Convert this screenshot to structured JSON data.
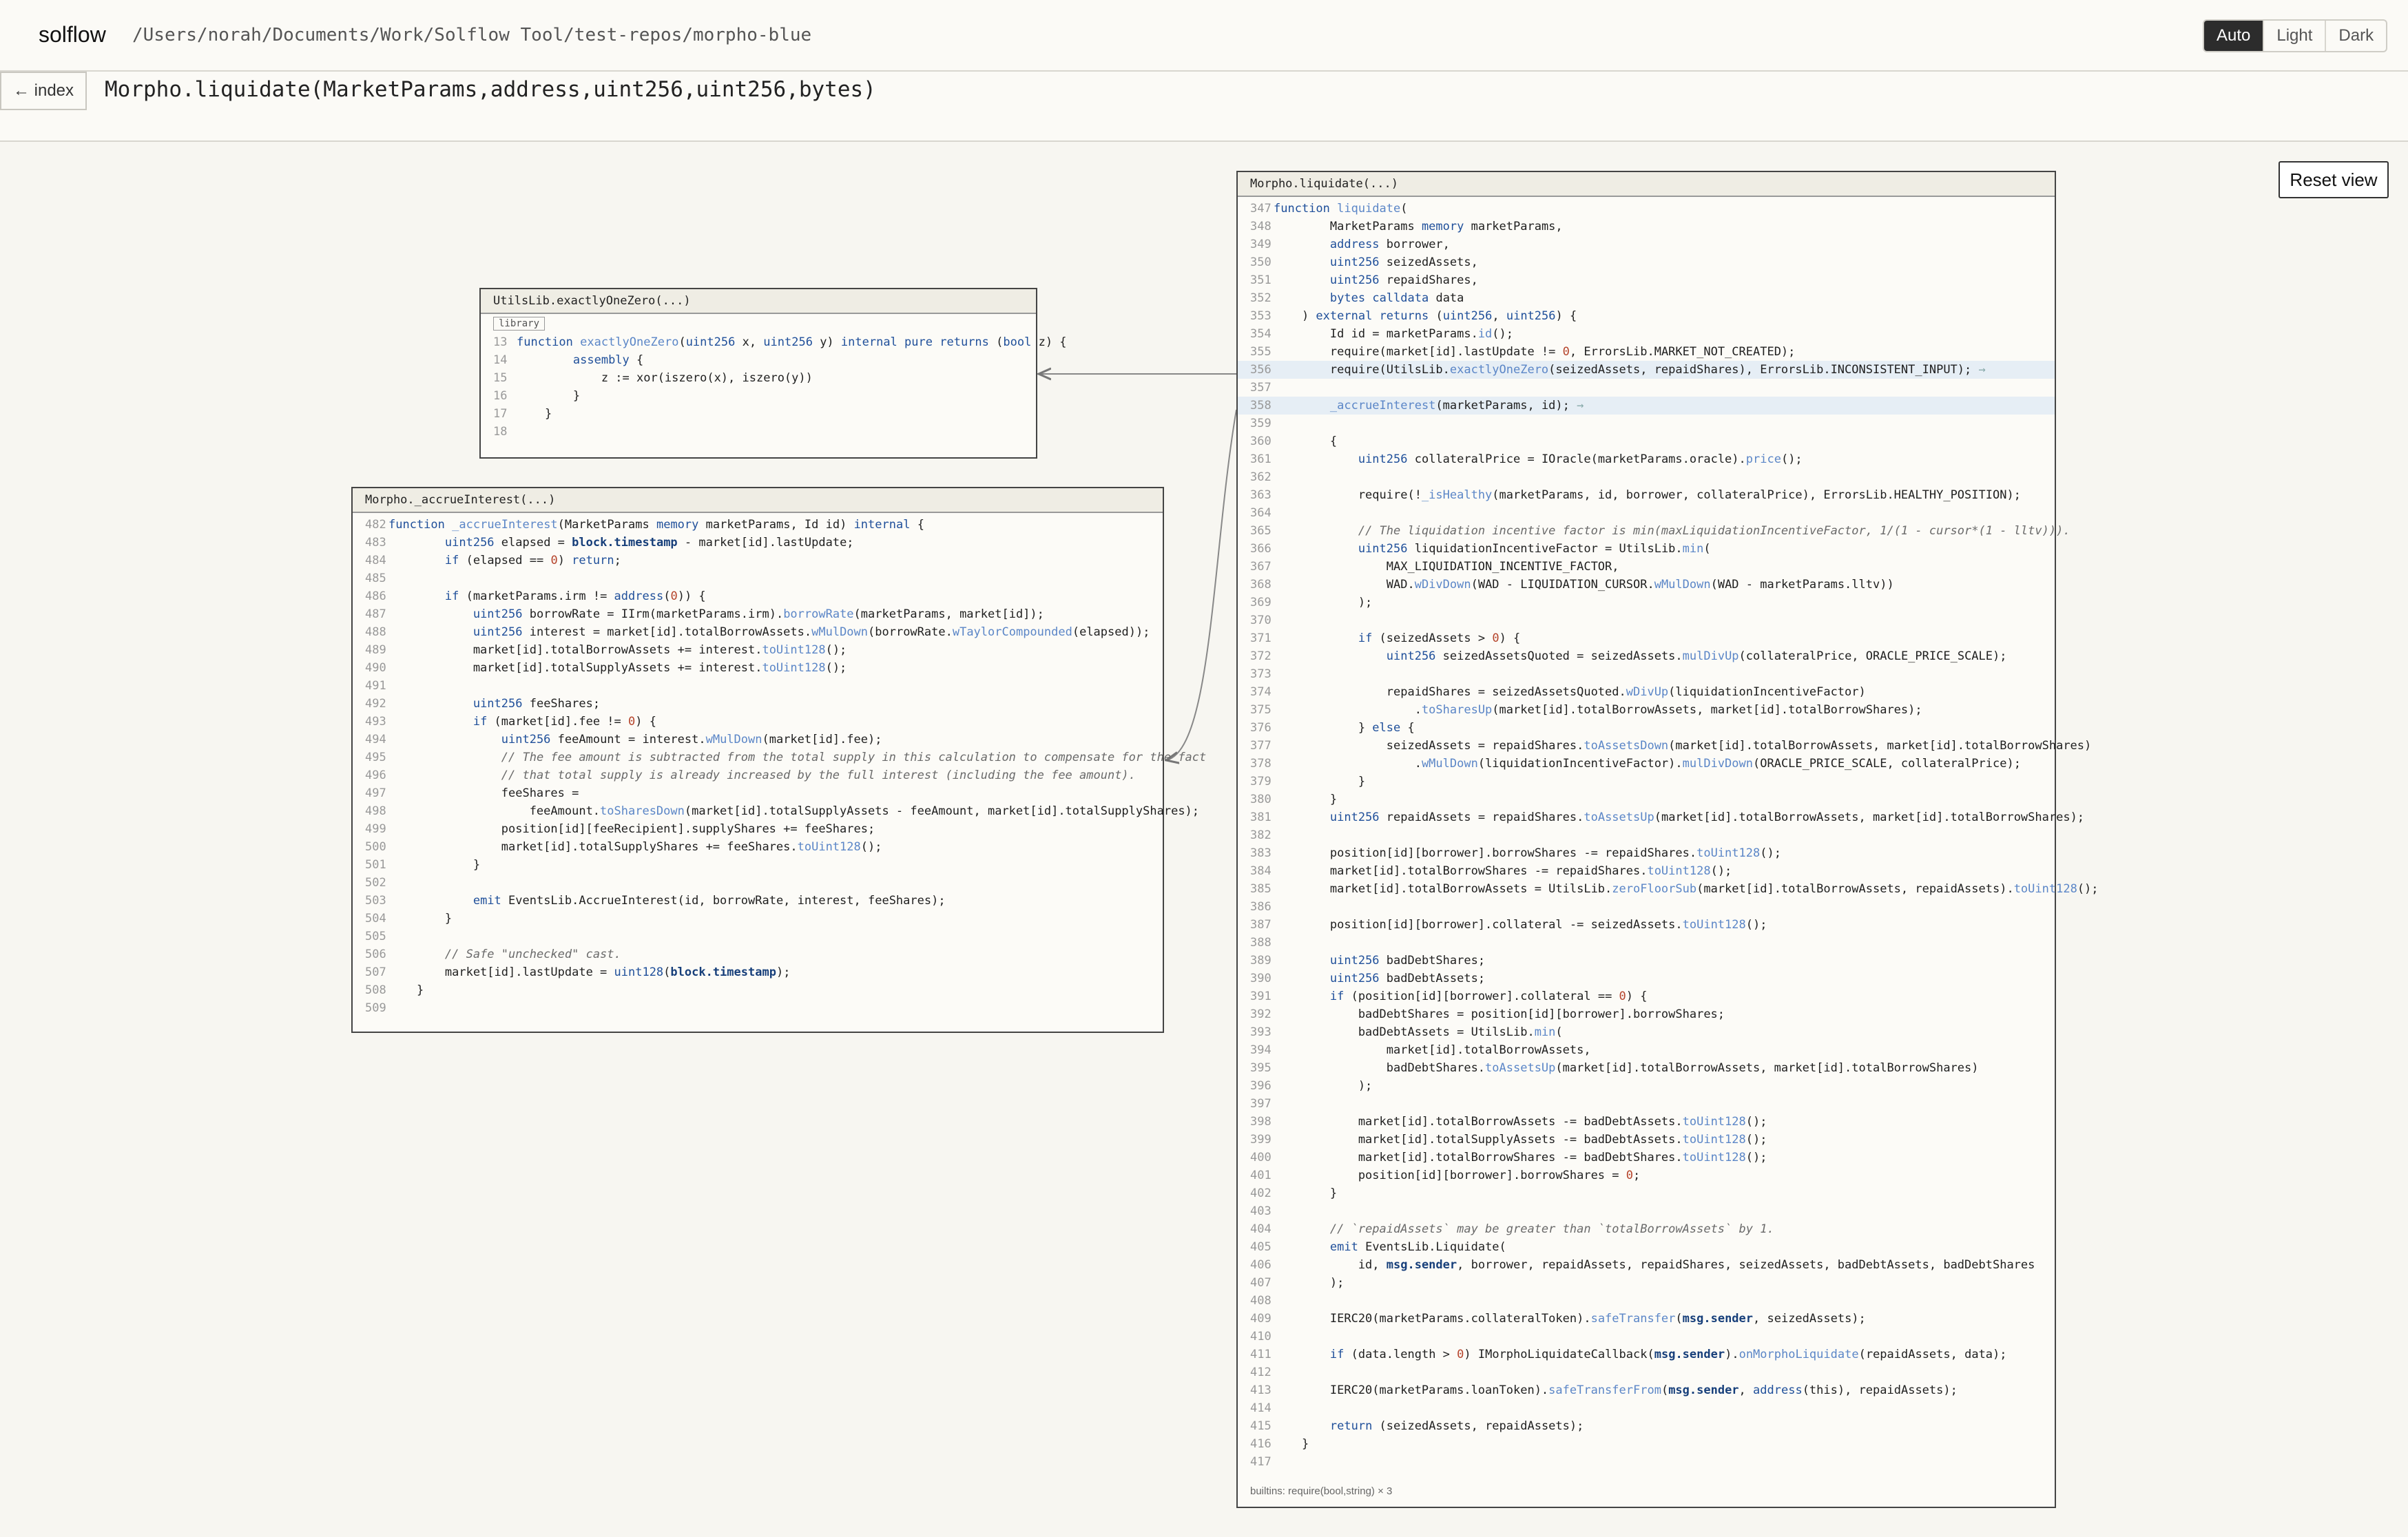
{
  "header": {
    "brand": "solflow",
    "path": "/Users/norah/Documents/Work/Solflow Tool/test-repos/morpho-blue",
    "themes": [
      "Auto",
      "Light",
      "Dark"
    ]
  },
  "toolbar": {
    "back_label": "← index",
    "signature": "Morpho.liquidate(MarketParams,address,uint256,uint256,bytes)",
    "reset_label": "Reset view"
  },
  "panels": {
    "exactly": {
      "title": "UtilsLib.exactlyOneZero(...)",
      "tag": "library",
      "start": 13,
      "lines": [
        "function exactlyOneZero(uint256 x, uint256 y) internal pure returns (bool z) {",
        "        assembly {",
        "            z := xor(iszero(x), iszero(y))",
        "        }",
        "    }",
        ""
      ]
    },
    "accrue": {
      "title": "Morpho._accrueInterest(...)",
      "start": 482,
      "lines": [
        "function _accrueInterest(MarketParams memory marketParams, Id id) internal {",
        "        uint256 elapsed = block.timestamp - market[id].lastUpdate;",
        "        if (elapsed == 0) return;",
        "",
        "        if (marketParams.irm != address(0)) {",
        "            uint256 borrowRate = IIrm(marketParams.irm).borrowRate(marketParams, market[id]);",
        "            uint256 interest = market[id].totalBorrowAssets.wMulDown(borrowRate.wTaylorCompounded(elapsed));",
        "            market[id].totalBorrowAssets += interest.toUint128();",
        "            market[id].totalSupplyAssets += interest.toUint128();",
        "",
        "            uint256 feeShares;",
        "            if (market[id].fee != 0) {",
        "                uint256 feeAmount = interest.wMulDown(market[id].fee);",
        "                // The fee amount is subtracted from the total supply in this calculation to compensate for the fact",
        "                // that total supply is already increased by the full interest (including the fee amount).",
        "                feeShares =",
        "                    feeAmount.toSharesDown(market[id].totalSupplyAssets - feeAmount, market[id].totalSupplyShares);",
        "                position[id][feeRecipient].supplyShares += feeShares;",
        "                market[id].totalSupplyShares += feeShares.toUint128();",
        "            }",
        "",
        "            emit EventsLib.AccrueInterest(id, borrowRate, interest, feeShares);",
        "        }",
        "",
        "        // Safe \"unchecked\" cast.",
        "        market[id].lastUpdate = uint128(block.timestamp);",
        "    }",
        ""
      ]
    },
    "liquidate": {
      "title": "Morpho.liquidate(...)",
      "start": 347,
      "footer": "builtins: require(bool,string) × 3",
      "lines": [
        "function liquidate(",
        "        MarketParams memory marketParams,",
        "        address borrower,",
        "        uint256 seizedAssets,",
        "        uint256 repaidShares,",
        "        bytes calldata data",
        "    ) external returns (uint256, uint256) {",
        "        Id id = marketParams.id();",
        "        require(market[id].lastUpdate != 0, ErrorsLib.MARKET_NOT_CREATED);",
        "        require(UtilsLib.exactlyOneZero(seizedAssets, repaidShares), ErrorsLib.INCONSISTENT_INPUT);",
        "",
        "        _accrueInterest(marketParams, id);",
        "",
        "        {",
        "            uint256 collateralPrice = IOracle(marketParams.oracle).price();",
        "",
        "            require(!_isHealthy(marketParams, id, borrower, collateralPrice), ErrorsLib.HEALTHY_POSITION);",
        "",
        "            // The liquidation incentive factor is min(maxLiquidationIncentiveFactor, 1/(1 - cursor*(1 - lltv))).",
        "            uint256 liquidationIncentiveFactor = UtilsLib.min(",
        "                MAX_LIQUIDATION_INCENTIVE_FACTOR,",
        "                WAD.wDivDown(WAD - LIQUIDATION_CURSOR.wMulDown(WAD - marketParams.lltv))",
        "            );",
        "",
        "            if (seizedAssets > 0) {",
        "                uint256 seizedAssetsQuoted = seizedAssets.mulDivUp(collateralPrice, ORACLE_PRICE_SCALE);",
        "",
        "                repaidShares = seizedAssetsQuoted.wDivUp(liquidationIncentiveFactor)",
        "                    .toSharesUp(market[id].totalBorrowAssets, market[id].totalBorrowShares);",
        "            } else {",
        "                seizedAssets = repaidShares.toAssetsDown(market[id].totalBorrowAssets, market[id].totalBorrowShares)",
        "                    .wMulDown(liquidationIncentiveFactor).mulDivDown(ORACLE_PRICE_SCALE, collateralPrice);",
        "            }",
        "        }",
        "        uint256 repaidAssets = repaidShares.toAssetsUp(market[id].totalBorrowAssets, market[id].totalBorrowShares);",
        "",
        "        position[id][borrower].borrowShares -= repaidShares.toUint128();",
        "        market[id].totalBorrowShares -= repaidShares.toUint128();",
        "        market[id].totalBorrowAssets = UtilsLib.zeroFloorSub(market[id].totalBorrowAssets, repaidAssets).toUint128();",
        "",
        "        position[id][borrower].collateral -= seizedAssets.toUint128();",
        "",
        "        uint256 badDebtShares;",
        "        uint256 badDebtAssets;",
        "        if (position[id][borrower].collateral == 0) {",
        "            badDebtShares = position[id][borrower].borrowShares;",
        "            badDebtAssets = UtilsLib.min(",
        "                market[id].totalBorrowAssets,",
        "                badDebtShares.toAssetsUp(market[id].totalBorrowAssets, market[id].totalBorrowShares)",
        "            );",
        "",
        "            market[id].totalBorrowAssets -= badDebtAssets.toUint128();",
        "            market[id].totalSupplyAssets -= badDebtAssets.toUint128();",
        "            market[id].totalBorrowShares -= badDebtShares.toUint128();",
        "            position[id][borrower].borrowShares = 0;",
        "        }",
        "",
        "        // `repaidAssets` may be greater than `totalBorrowAssets` by 1.",
        "        emit EventsLib.Liquidate(",
        "            id, msg.sender, borrower, repaidAssets, repaidShares, seizedAssets, badDebtAssets, badDebtShares",
        "        );",
        "",
        "        IERC20(marketParams.collateralToken).safeTransfer(msg.sender, seizedAssets);",
        "",
        "        if (data.length > 0) IMorphoLiquidateCallback(msg.sender).onMorphoLiquidate(repaidAssets, data);",
        "",
        "        IERC20(marketParams.loanToken).safeTransferFrom(msg.sender, address(this), repaidAssets);",
        "",
        "        return (seizedAssets, repaidAssets);",
        "    }",
        ""
      ],
      "call_markers": [
        {
          "line": 356,
          "text": "→"
        },
        {
          "line": 358,
          "text": "→"
        }
      ]
    }
  },
  "colors": {
    "keyword": "#1f4f9a",
    "fn": "#5b86c7",
    "bold": "#173f7a",
    "number": "#b5442b",
    "comment": "#6a6a6a"
  }
}
